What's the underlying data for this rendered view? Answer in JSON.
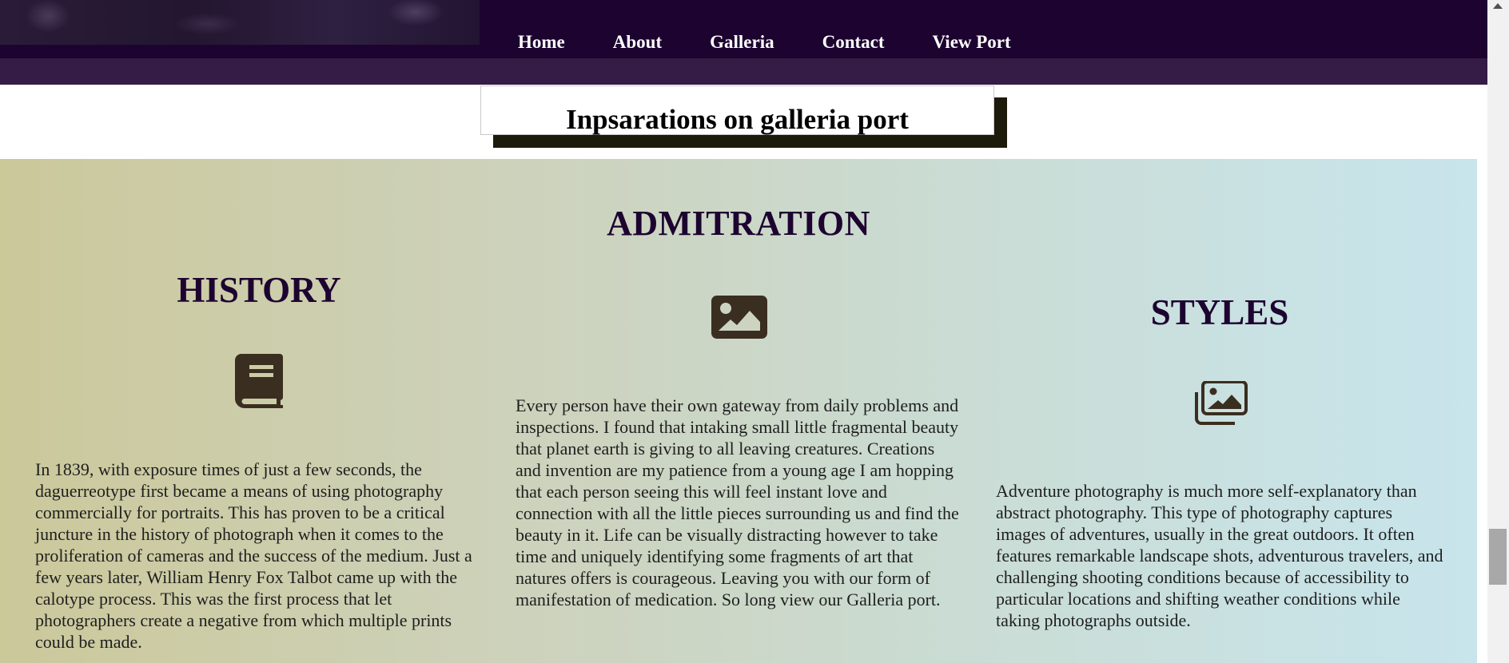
{
  "nav": {
    "links": [
      "Home",
      "About",
      "Galleria",
      "Contact",
      "View Port"
    ]
  },
  "title_box": {
    "text": "Inpsarations on galleria port"
  },
  "main": {
    "heading": "ADMITRATION",
    "columns": [
      {
        "heading": "HISTORY",
        "icon": "book-icon",
        "text": "In 1839, with exposure times of just a few seconds, the daguerreotype first became a means of using photography commercially for portraits. This has proven to be a critical juncture in the history of photograph when it comes to the proliferation of cameras and the success of the medium. Just a few years later, William Henry Fox Talbot came up with the calotype process. This was the first process that let photographers create a negative from which multiple prints could be made."
      },
      {
        "heading": "",
        "icon": "image-icon",
        "text": "Every person have their own gateway from daily problems and inspections. I found that intaking small little fragmental beauty that planet earth is giving to all leaving creatures. Creations and invention are my patience from a young age I am hopping that each person seeing this will feel instant love and connection with all the little pieces surrounding us and find the beauty in it. Life can be visually distracting however to take time and uniquely identifying some fragments of art that natures offers is courageous. Leaving you with our form of manifestation of medication. So long view our Galleria port."
      },
      {
        "heading": "STYLES",
        "icon": "images-icon",
        "text": "Adventure photography is much more self-explanatory than abstract photography. This type of photography captures images of adventures, usually in the great outdoors. It often features remarkable landscape shots, adventurous travelers, and challenging shooting conditions because of accessibility to particular locations and shifting weather conditions while taking photographs outside."
      }
    ]
  },
  "colors": {
    "nav_bg": "#1d0430",
    "heading": "#1d0430",
    "icon": "#3a2e20"
  }
}
